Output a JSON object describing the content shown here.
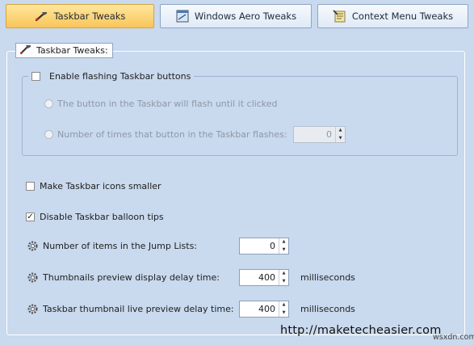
{
  "tabs": [
    {
      "label": "Taskbar Tweaks",
      "icon": "wrench-icon",
      "active": true
    },
    {
      "label": "Windows Aero Tweaks",
      "icon": "window-icon",
      "active": false
    },
    {
      "label": "Context Menu Tweaks",
      "icon": "context-menu-icon",
      "active": false
    }
  ],
  "panel": {
    "title": "Taskbar Tweaks:"
  },
  "flash_group": {
    "label": "Enable flashing Taskbar buttons",
    "checked": false,
    "radio_until_click": "The button in the Taskbar will flash until it clicked",
    "radio_times": "Number of times that button in the Taskbar flashes:",
    "times_value": "0"
  },
  "options": {
    "smaller_icons": {
      "label": "Make Taskbar icons smaller",
      "checked": false
    },
    "balloon_tips": {
      "label": "Disable Taskbar balloon tips",
      "checked": true
    }
  },
  "settings": {
    "jump_lists": {
      "label": "Number of items in the Jump Lists:",
      "value": "0"
    },
    "thumb_delay": {
      "label": "Thumbnails preview display delay time:",
      "value": "400",
      "unit": "milliseconds"
    },
    "live_delay": {
      "label": "Taskbar thumbnail live preview delay time:",
      "value": "400",
      "unit": "milliseconds"
    }
  },
  "check_mark": "✓",
  "spin_up": "▲",
  "spin_down": "▼",
  "watermark": "http://maketecheasier.com",
  "watermark_small": "wsxdn.com"
}
